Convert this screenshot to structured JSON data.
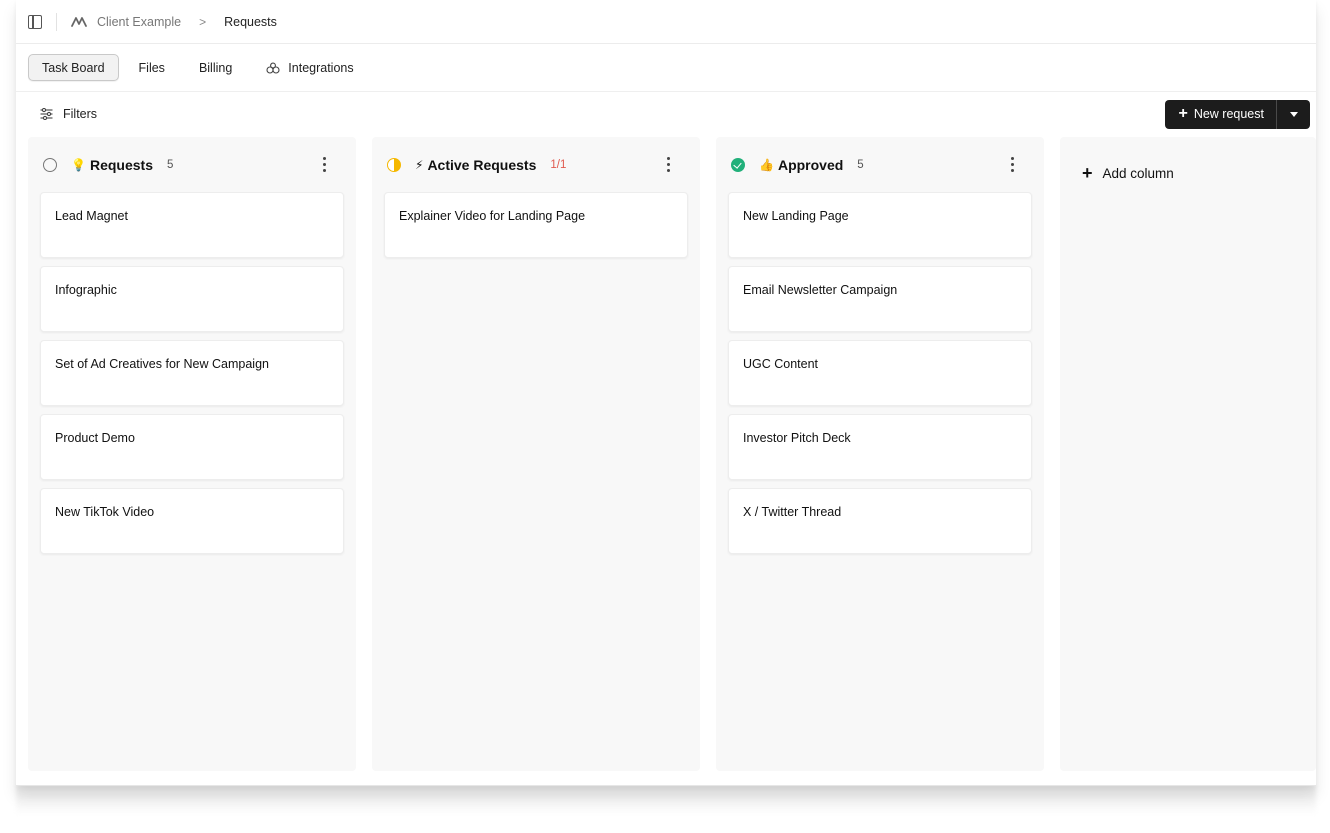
{
  "breadcrumb": {
    "workspace": "Client Example",
    "separator": ">",
    "current": "Requests"
  },
  "tabs": [
    {
      "label": "Task Board",
      "active": true
    },
    {
      "label": "Files"
    },
    {
      "label": "Billing"
    },
    {
      "label": "Integrations",
      "icon": "integrations-icon"
    }
  ],
  "toolbar": {
    "filters_label": "Filters",
    "new_request_label": "New request"
  },
  "columns": [
    {
      "emoji": "💡",
      "title": "Requests",
      "count": "5",
      "status": "open",
      "cards": [
        "Lead Magnet",
        "Infographic",
        "Set of Ad Creatives for New Campaign",
        "Product Demo",
        "New TikTok Video"
      ]
    },
    {
      "emoji": "⚡",
      "title": "Active Requests",
      "count": "1/1",
      "status": "in-progress",
      "cards": [
        "Explainer Video for Landing Page"
      ]
    },
    {
      "emoji": "👍",
      "title": "Approved",
      "count": "5",
      "status": "done",
      "cards": [
        "New Landing Page",
        "Email Newsletter Campaign",
        "UGC Content",
        "Investor Pitch Deck",
        "X / Twitter Thread"
      ]
    }
  ],
  "add_column_label": "Add column",
  "colors": {
    "accent_dark": "#1c1c1c",
    "in_progress": "#f5b800",
    "done": "#21b07a",
    "limit": "#e05a4f"
  }
}
